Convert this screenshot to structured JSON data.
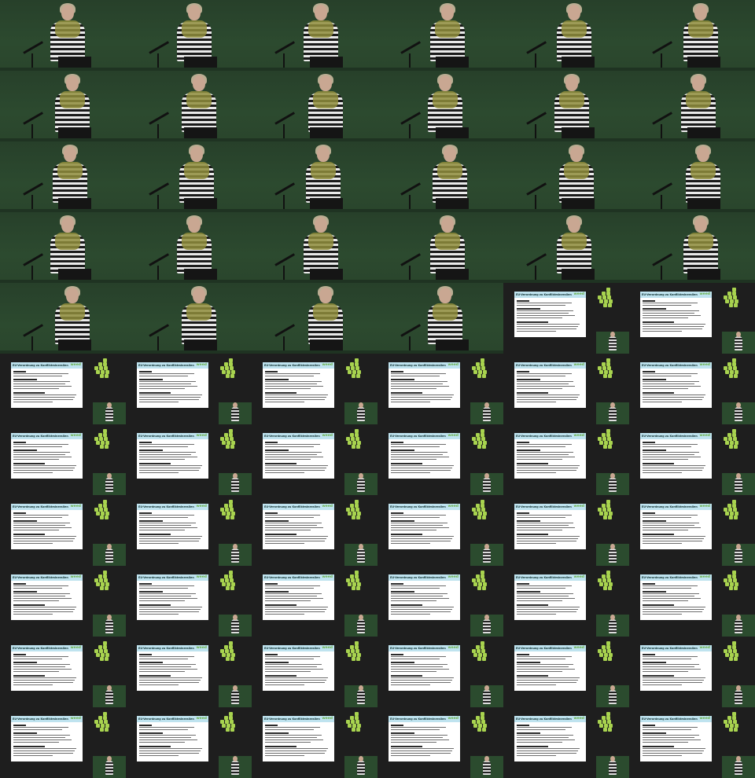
{
  "sheet": {
    "columns": 6,
    "rows": 11,
    "speaker_frame_count": 28,
    "slide_frame_count": 38
  },
  "slide": {
    "title": "EU-Verordnung zu Konfliktmineralien",
    "brand": "weed"
  },
  "colors": {
    "stage_green": "#2c4a2f",
    "slide_header": "#bfe3ef",
    "logo_green": "#a8d34f",
    "background": "#2f2f2f"
  }
}
